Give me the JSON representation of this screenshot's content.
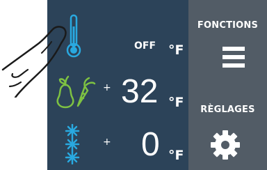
{
  "sidebar": {
    "functions_label": "FONCTIONS",
    "settings_label": "RÈGLAGES",
    "menu_icon": "hamburger-menu-icon",
    "settings_icon": "gear-icon"
  },
  "freezer_mode": {
    "status": "OFF",
    "unit": "°F",
    "icon": "thermometer-icon"
  },
  "fresh_zone": {
    "sign": "+",
    "value": "32",
    "unit": "°F",
    "icon": "pear-carrot-icon"
  },
  "freezer_zone": {
    "sign": "+",
    "value": "0",
    "unit": "°F",
    "icon": "snowflake-icon"
  },
  "colors": {
    "panel": "#2c4359",
    "sidebar": "#525c66",
    "accent_green": "#7ec242",
    "accent_blue": "#29a9e0"
  }
}
